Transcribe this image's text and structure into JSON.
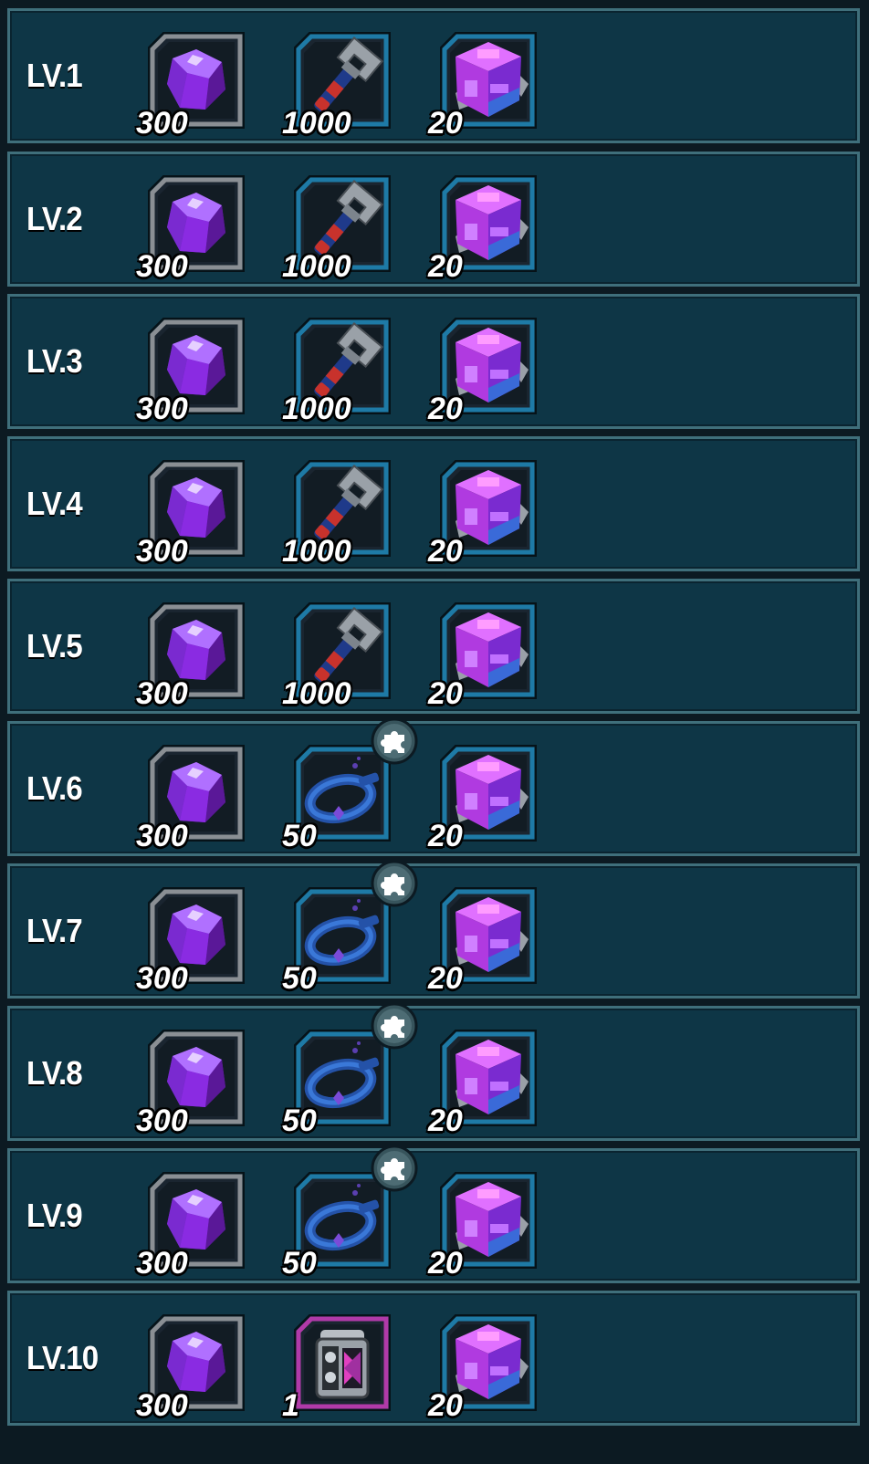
{
  "colors": {
    "row_bg": "#0e3646",
    "row_border": "#3f6f7b",
    "frame_gray": "#8a8f94",
    "frame_blue": "#1e7aa6",
    "frame_purple": "#b03aa8",
    "gem_purple": "#8a2be2",
    "cube_magenta": "#c040f0"
  },
  "rows": [
    {
      "level": "LV.1",
      "items": [
        {
          "icon": "purple-gem-icon",
          "qty": "300"
        },
        {
          "icon": "wrench-icon",
          "qty": "1000"
        },
        {
          "icon": "purple-cube-icon",
          "qty": "20"
        }
      ]
    },
    {
      "level": "LV.2",
      "items": [
        {
          "icon": "purple-gem-icon",
          "qty": "300"
        },
        {
          "icon": "wrench-icon",
          "qty": "1000"
        },
        {
          "icon": "purple-cube-icon",
          "qty": "20"
        }
      ]
    },
    {
      "level": "LV.3",
      "items": [
        {
          "icon": "purple-gem-icon",
          "qty": "300"
        },
        {
          "icon": "wrench-icon",
          "qty": "1000"
        },
        {
          "icon": "purple-cube-icon",
          "qty": "20"
        }
      ]
    },
    {
      "level": "LV.4",
      "items": [
        {
          "icon": "purple-gem-icon",
          "qty": "300"
        },
        {
          "icon": "wrench-icon",
          "qty": "1000"
        },
        {
          "icon": "purple-cube-icon",
          "qty": "20"
        }
      ]
    },
    {
      "level": "LV.5",
      "items": [
        {
          "icon": "purple-gem-icon",
          "qty": "300"
        },
        {
          "icon": "wrench-icon",
          "qty": "1000"
        },
        {
          "icon": "purple-cube-icon",
          "qty": "20"
        }
      ]
    },
    {
      "level": "LV.6",
      "items": [
        {
          "icon": "purple-gem-icon",
          "qty": "300"
        },
        {
          "icon": "blue-collar-fragment-icon",
          "qty": "50"
        },
        {
          "icon": "purple-cube-icon",
          "qty": "20"
        }
      ]
    },
    {
      "level": "LV.7",
      "items": [
        {
          "icon": "purple-gem-icon",
          "qty": "300"
        },
        {
          "icon": "blue-collar-fragment-icon",
          "qty": "50"
        },
        {
          "icon": "purple-cube-icon",
          "qty": "20"
        }
      ]
    },
    {
      "level": "LV.8",
      "items": [
        {
          "icon": "purple-gem-icon",
          "qty": "300"
        },
        {
          "icon": "blue-collar-fragment-icon",
          "qty": "50"
        },
        {
          "icon": "purple-cube-icon",
          "qty": "20"
        }
      ]
    },
    {
      "level": "LV.9",
      "items": [
        {
          "icon": "purple-gem-icon",
          "qty": "300"
        },
        {
          "icon": "blue-collar-fragment-icon",
          "qty": "50"
        },
        {
          "icon": "purple-cube-icon",
          "qty": "20"
        }
      ]
    },
    {
      "level": "LV.10",
      "items": [
        {
          "icon": "purple-gem-icon",
          "qty": "300"
        },
        {
          "icon": "mechanical-device-icon",
          "qty": "1"
        },
        {
          "icon": "purple-cube-icon",
          "qty": "20"
        }
      ]
    }
  ]
}
